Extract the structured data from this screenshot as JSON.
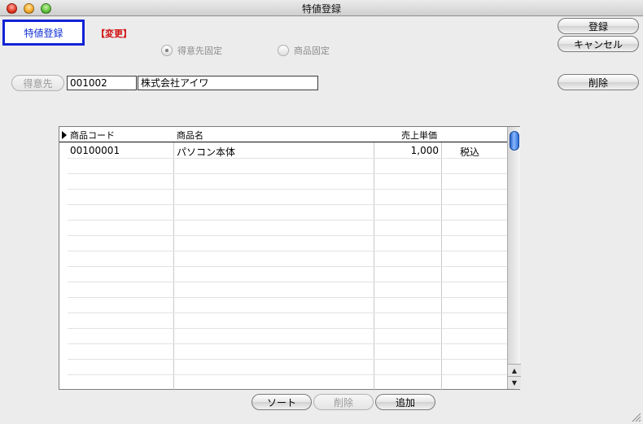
{
  "window": {
    "title": "特値登録"
  },
  "mode_label": "特値登録",
  "status_label": "【変更】",
  "radios": [
    {
      "label": "得意先固定",
      "checked": true
    },
    {
      "label": "商品固定",
      "checked": false
    }
  ],
  "customer": {
    "button_label": "得意先",
    "code": "001002",
    "name": "株式会社アイワ"
  },
  "right_buttons": {
    "register": "登録",
    "cancel": "キャンセル",
    "delete": "削除"
  },
  "table": {
    "columns": [
      "商品コード",
      "商品名",
      "売上単価"
    ],
    "rows": [
      {
        "code": "00100001",
        "name": "パソコン本体",
        "price": "1,000",
        "tax": "税込"
      }
    ]
  },
  "bottom_buttons": {
    "sort": "ソート",
    "delete": "削除",
    "add": "追加"
  }
}
